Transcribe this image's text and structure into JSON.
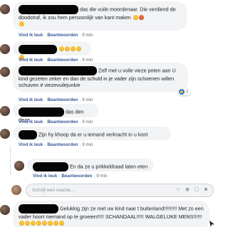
{
  "comments": [
    {
      "text": "das die vuile moordenaar. Die verdiend de doodstraf, ik zou hem persoonlijk van kant maken",
      "like_label": "Vind ik leuk",
      "reply_label": "Beantwoorden",
      "time": "9 min"
    },
    {
      "text": "",
      "like_label": "Vind ik leuk",
      "reply_label": "Beantwoorden",
      "time": "9 min"
    },
    {
      "text": "Zelf met u vuile vieze poten aan U kind gezeten zeker en dan de schuld in je vader zijn schoenen willen schuiven # viezevuilejunkie",
      "like_label": "Vind ik leuk",
      "reply_label": "Beantwoorden",
      "time": "9 min",
      "reaction_count": "2"
    },
    {
      "text": "das den deze",
      "like_label": "Vind ik leuk",
      "reply_label": "Beantwoorden",
      "time": "9 min"
    },
    {
      "text": "Zijn hy khoop da er u iemand verkracht in u kont",
      "like_label": "Vind ik leuk",
      "reply_label": "Beantwoorden",
      "time": "9 min"
    },
    {
      "text": "En da ze u prikkeldraad laten eten",
      "like_label": "Vind ik leuk",
      "reply_label": "Beantwoorden",
      "time": "9 min"
    },
    {
      "text": "Gelukkig zijn ze met uw kind naar t buitenland!!!!!!!!! Met zo een vader hoort niemand op te groeien!!!!! SCHANDAAL!!!!! WALGELIJKE MENS!!!!!!"
    }
  ],
  "reply_box": {
    "placeholder": "Schrijf een reactie..."
  },
  "colors": {
    "bubble": "#f2f3f5",
    "link": "#385898",
    "meta": "#606770",
    "like_blue": "#1877f2"
  }
}
